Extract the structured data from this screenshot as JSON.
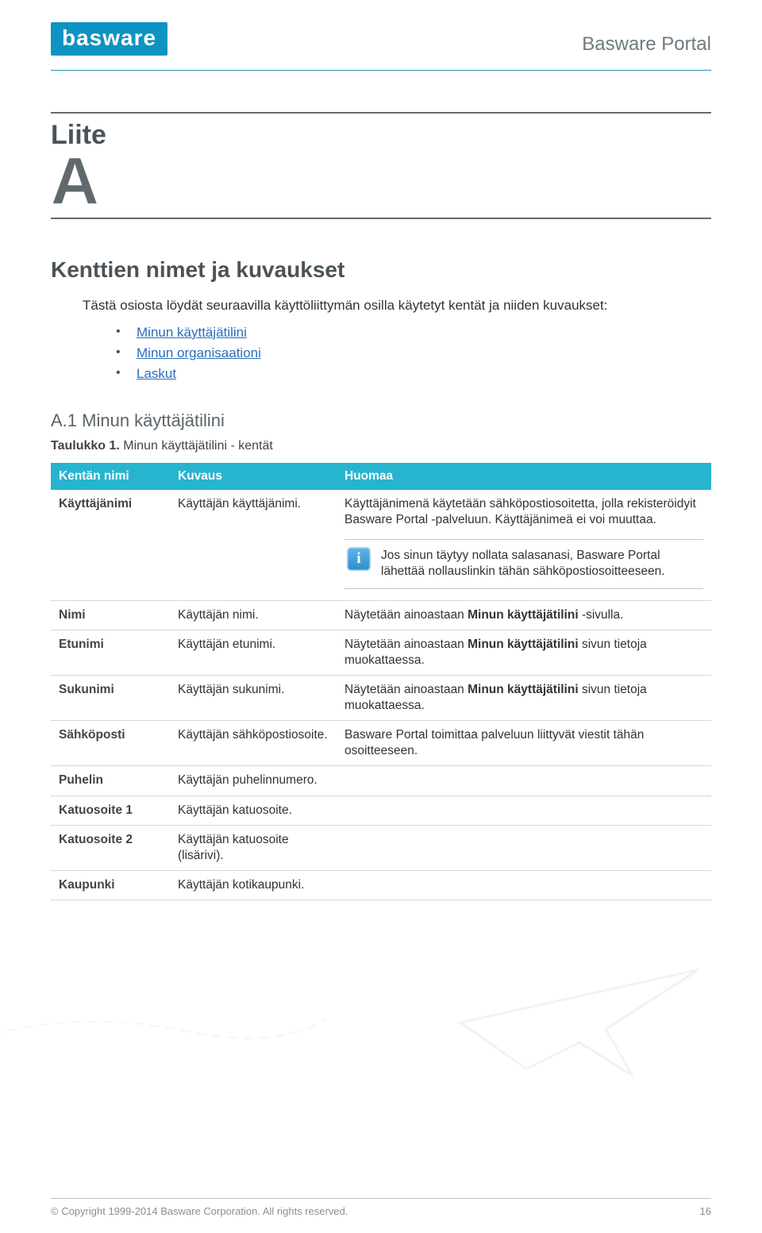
{
  "header": {
    "logo_text": "basware",
    "portal_title": "Basware Portal"
  },
  "appendix": {
    "label": "Liite",
    "letter": "A"
  },
  "section_title": "Kenttien nimet ja kuvaukset",
  "intro_text": "Tästä osiosta löydät seuraavilla käyttöliittymän osilla käytetyt kentät ja niiden kuvaukset:",
  "links": [
    "Minun käyttäjätilini",
    "Minun organisaationi",
    "Laskut"
  ],
  "subsection_title": "A.1 Minun käyttäjätilini",
  "table_caption_bold": "Taulukko 1.",
  "table_caption_rest": " Minun käyttäjätilini - kentät",
  "table_headers": [
    "Kentän nimi",
    "Kuvaus",
    "Huomaa"
  ],
  "rows": [
    {
      "name": "Käyttäjänimi",
      "desc": "Käyttäjän käyttäjänimi.",
      "note": "Käyttäjänimenä käytetään sähköpostiosoitetta, jolla rekisteröidyit Basware Portal -palveluun. Käyttäjänimeä ei voi muuttaa.",
      "info": "Jos sinun täytyy nollata salasanasi, Basware Portal lähettää nollauslinkin tähän sähköpostiosoitteeseen."
    },
    {
      "name": "Nimi",
      "desc": "Käyttäjän nimi.",
      "note_pre": "Näytetään ainoastaan ",
      "note_bold": "Minun käyttäjätilini",
      "note_post": " -sivulla."
    },
    {
      "name": "Etunimi",
      "desc": "Käyttäjän etunimi.",
      "note_pre": "Näytetään ainoastaan ",
      "note_bold": "Minun käyttäjätilini",
      "note_post": " sivun tietoja muokattaessa."
    },
    {
      "name": "Sukunimi",
      "desc": "Käyttäjän sukunimi.",
      "note_pre": "Näytetään ainoastaan ",
      "note_bold": "Minun käyttäjätilini",
      "note_post": " sivun tietoja muokattaessa."
    },
    {
      "name": "Sähköposti",
      "desc": "Käyttäjän sähköpostiosoite.",
      "note": "Basware Portal toimittaa palveluun liittyvät viestit tähän osoitteeseen."
    },
    {
      "name": "Puhelin",
      "desc": "Käyttäjän puhelinnumero.",
      "note": ""
    },
    {
      "name": "Katuosoite 1",
      "desc": "Käyttäjän katuosoite.",
      "note": ""
    },
    {
      "name": "Katuosoite 2",
      "desc": "Käyttäjän katuosoite (lisärivi).",
      "note": ""
    },
    {
      "name": "Kaupunki",
      "desc": "Käyttäjän kotikaupunki.",
      "note": ""
    }
  ],
  "footer": {
    "copyright": "© Copyright 1999-2014 Basware Corporation. All rights reserved.",
    "page": "16"
  }
}
